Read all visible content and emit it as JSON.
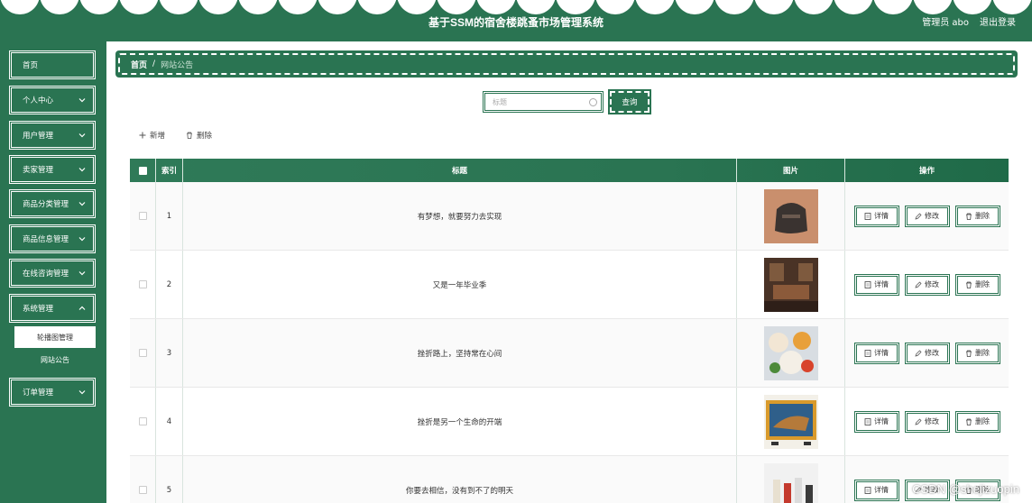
{
  "header": {
    "title": "基于SSM的宿舍楼跳蚤市场管理系统",
    "user": "管理员 abo",
    "logout": "退出登录"
  },
  "sidebar": {
    "items": [
      {
        "label": "首页"
      },
      {
        "label": "个人中心"
      },
      {
        "label": "用户管理"
      },
      {
        "label": "卖家管理"
      },
      {
        "label": "商品分类管理"
      },
      {
        "label": "商品信息管理"
      },
      {
        "label": "在线咨询管理"
      },
      {
        "label": "系统管理"
      },
      {
        "label": "订单管理"
      }
    ],
    "submenu": [
      {
        "label": "轮播图管理"
      },
      {
        "label": "网站公告"
      }
    ]
  },
  "breadcrumb": {
    "home": "首页",
    "sep": "/",
    "current": "网站公告"
  },
  "search": {
    "placeholder": "标题",
    "button": "查询"
  },
  "toolbar": {
    "add": "新增",
    "delete": "删除"
  },
  "table": {
    "headers": {
      "index": "索引",
      "title": "标题",
      "image": "图片",
      "ops": "操作"
    },
    "rows": [
      {
        "index": "1",
        "title": "有梦想，就要努力去实现"
      },
      {
        "index": "2",
        "title": "又是一年毕业季"
      },
      {
        "index": "3",
        "title": "挫折路上，坚持常在心间"
      },
      {
        "index": "4",
        "title": "挫折是另一个生命的开端"
      },
      {
        "index": "5",
        "title": "你要去相信，没有到不了的明天"
      }
    ],
    "ops": {
      "detail": "详情",
      "edit": "修改",
      "delete": "删除"
    }
  },
  "watermark": "CSDN @shejizuopin"
}
